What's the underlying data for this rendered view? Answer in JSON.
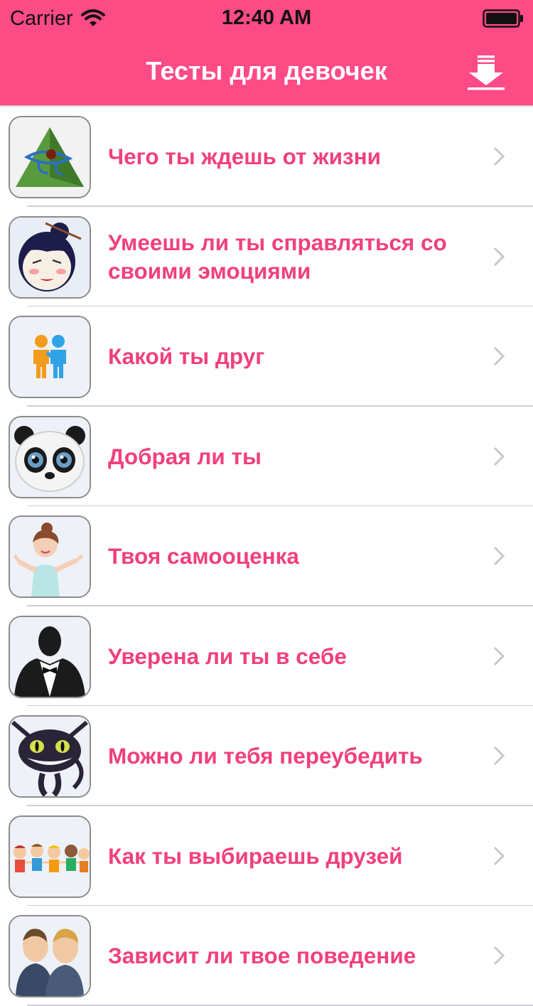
{
  "status_bar": {
    "carrier": "Carrier",
    "time": "12:40 AM"
  },
  "nav": {
    "title": "Тесты для девочек",
    "download_icon": "download-icon"
  },
  "colors": {
    "header": "#fd4b85",
    "item_text": "#f1407c",
    "chevron": "#c7c7cc"
  },
  "tests": [
    {
      "title": "Чего ты ждешь от жизни",
      "icon": "eye-pyramid-icon"
    },
    {
      "title": "Умеешь ли ты справляться со своими эмоциями",
      "icon": "girl-face-icon"
    },
    {
      "title": "Какой ты друг",
      "icon": "two-friends-icon"
    },
    {
      "title": "Добрая ли ты",
      "icon": "panda-icon"
    },
    {
      "title": "Твоя самооценка",
      "icon": "smiling-woman-icon"
    },
    {
      "title": "Уверена ли ты в себе",
      "icon": "tuxedo-silhouette-icon"
    },
    {
      "title": "Можно ли тебя переубедить",
      "icon": "cheshire-cat-icon"
    },
    {
      "title": "Как ты выбираешь друзей",
      "icon": "kids-holding-hands-icon"
    },
    {
      "title": "Зависит ли твое поведение",
      "icon": "two-men-icon"
    }
  ]
}
